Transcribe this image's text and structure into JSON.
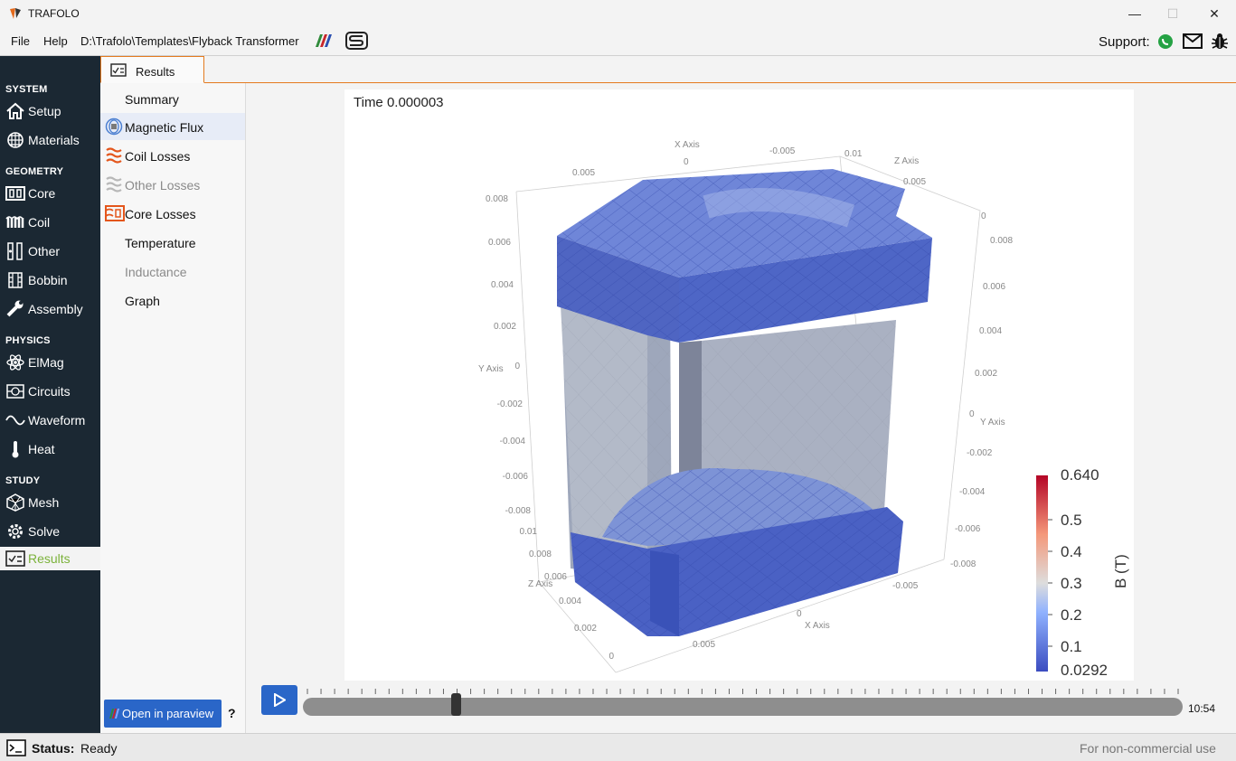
{
  "window": {
    "title": "TRAFOLO",
    "minimize_glyph": "—",
    "maximize_glyph": "☐",
    "close_glyph": "✕"
  },
  "menu": {
    "file": "File",
    "help": "Help",
    "path": "D:\\Trafolo\\Templates\\Flyback Transformer",
    "support_label": "Support:"
  },
  "sidebar": {
    "sections": [
      {
        "label": "SYSTEM",
        "items": [
          {
            "label": "Setup",
            "icon": "home-icon"
          },
          {
            "label": "Materials",
            "icon": "grid-icon"
          }
        ]
      },
      {
        "label": "GEOMETRY",
        "items": [
          {
            "label": "Core",
            "icon": "core-icon"
          },
          {
            "label": "Coil",
            "icon": "coil-icon"
          },
          {
            "label": "Other",
            "icon": "other-icon"
          },
          {
            "label": "Bobbin",
            "icon": "bobbin-icon"
          },
          {
            "label": "Assembly",
            "icon": "wrench-icon"
          }
        ]
      },
      {
        "label": "PHYSICS",
        "items": [
          {
            "label": "ElMag",
            "icon": "atom-icon"
          },
          {
            "label": "Circuits",
            "icon": "circuit-icon"
          },
          {
            "label": "Waveform",
            "icon": "wave-icon"
          },
          {
            "label": "Heat",
            "icon": "thermometer-icon"
          }
        ]
      },
      {
        "label": "STUDY",
        "items": [
          {
            "label": "Mesh",
            "icon": "mesh-icon"
          },
          {
            "label": "Solve",
            "icon": "gear-icon"
          },
          {
            "label": "Results",
            "icon": "results-icon"
          }
        ]
      }
    ],
    "active": "Results"
  },
  "tab": {
    "label": "Results"
  },
  "subnav": {
    "items": [
      {
        "label": "Summary",
        "state": "normal"
      },
      {
        "label": "Magnetic Flux",
        "state": "selected"
      },
      {
        "label": "Coil Losses",
        "state": "normal"
      },
      {
        "label": "Other Losses",
        "state": "disabled"
      },
      {
        "label": "Core Losses",
        "state": "normal"
      },
      {
        "label": "Temperature",
        "state": "normal"
      },
      {
        "label": "Inductance",
        "state": "disabled"
      },
      {
        "label": "Graph",
        "state": "normal"
      }
    ],
    "paraview_button": "Open in paraview",
    "help": "?"
  },
  "viewport": {
    "time_label": "Time 0.000003",
    "axis_titles": {
      "x": "X Axis",
      "y": "Y Axis",
      "z": "Z Axis"
    },
    "y_left_ticks": [
      "0.008",
      "0.006",
      "0.004",
      "0.002",
      "0",
      "-0.002",
      "-0.004",
      "-0.006",
      "-0.008"
    ],
    "y_right_ticks": [
      "0.008",
      "0.006",
      "0.004",
      "0.002",
      "0",
      "-0.002",
      "-0.004",
      "-0.006",
      "-0.008"
    ],
    "z_left_ticks": [
      "0.01",
      "0.008",
      "0.006",
      "0.004",
      "0.002",
      "0"
    ],
    "x_top_ticks": [
      "0.005",
      "0",
      "-0.005",
      "0.01"
    ],
    "z_top_ticks": [
      "0.005",
      "0"
    ],
    "x_bottom_ticks": [
      "0.005",
      "0",
      "-0.005"
    ],
    "colorbar": {
      "title": "B (T)",
      "max": "0.640",
      "min": "0.0292",
      "ticks": [
        "0.5",
        "0.4",
        "0.3",
        "0.2",
        "0.1"
      ],
      "colors": {
        "high": "#b40426",
        "mid": "#dddddd",
        "low": "#3b4cc0"
      }
    }
  },
  "playback": {
    "progress": 0.17,
    "time": "10:54"
  },
  "status": {
    "label": "Status:",
    "value": "Ready",
    "license": "For non-commercial use"
  },
  "colors": {
    "accent": "#2a66c8",
    "sidebar_bg": "#1b2833",
    "tab_border": "#e47a1e",
    "active_green": "#7bb23a"
  }
}
